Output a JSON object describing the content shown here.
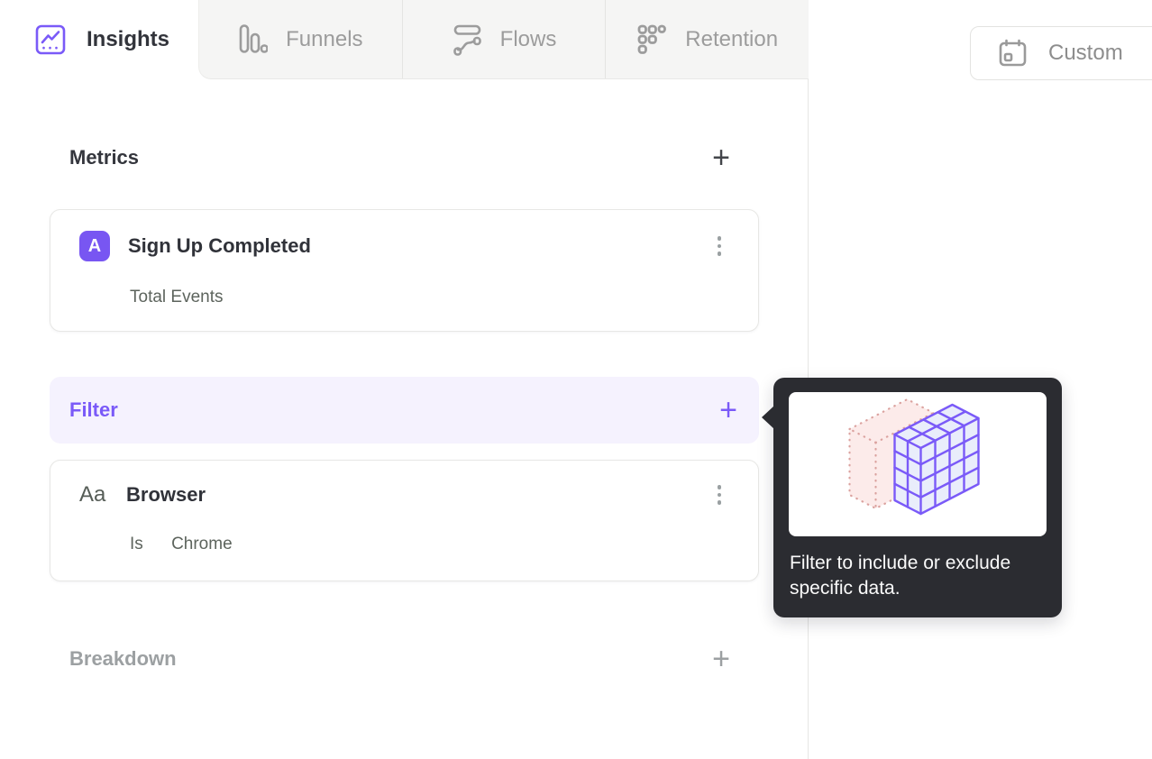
{
  "colors": {
    "accent_purple": "#7a5af8",
    "badge_purple": "#7856f2",
    "filter_row_bg": "#f5f2fe",
    "inactive_tab_bg": "#f5f5f4",
    "tooltip_bg": "#2b2c31",
    "pink_cube_stroke": "#dba29f",
    "muted_grey_text": "#9c9c9c",
    "subtitle_text": "#5d645d"
  },
  "tabs": [
    {
      "label": "Insights",
      "icon": "line-chart-icon",
      "active": true
    },
    {
      "label": "Funnels",
      "icon": "funnel-bars-icon",
      "active": false
    },
    {
      "label": "Flows",
      "icon": "flow-wave-icon",
      "active": false
    },
    {
      "label": "Retention",
      "icon": "dots-grid-icon",
      "active": false
    }
  ],
  "toolbar": {
    "date_range_label": "Custom",
    "date_range_icon": "calendar-icon"
  },
  "builder": {
    "metrics": {
      "heading": "Metrics",
      "add_label": "+"
    },
    "metric_card": {
      "badge": "A",
      "title": "Sign Up Completed",
      "subtitle": "Total Events"
    },
    "filter": {
      "heading": "Filter",
      "add_label": "+"
    },
    "filter_card": {
      "icon_label": "Aa",
      "title": "Browser",
      "operator": "Is",
      "value": "Chrome"
    },
    "breakdown": {
      "heading": "Breakdown",
      "add_label": "+"
    }
  },
  "tooltip": {
    "text": "Filter to include or exclude specific data.",
    "illustration": "filter-cube-illustration"
  }
}
